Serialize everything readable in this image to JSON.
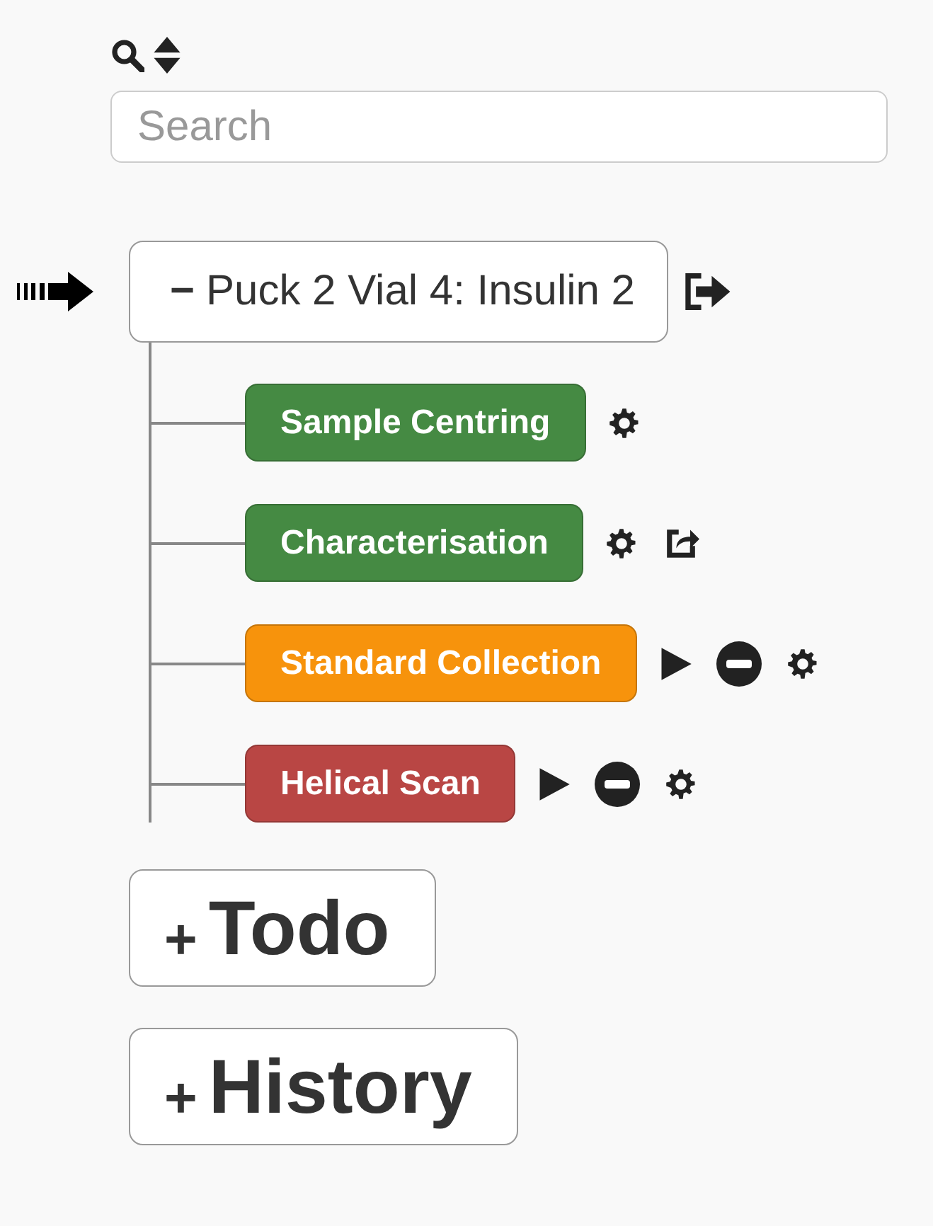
{
  "search": {
    "placeholder": "Search"
  },
  "sample": {
    "sign": "−",
    "label": "Puck 2 Vial 4: Insulin 2",
    "current": true
  },
  "tasks": [
    {
      "label": "Sample Centring",
      "color": "#458a43",
      "actions": [
        {
          "kind": "settings"
        }
      ]
    },
    {
      "label": "Characterisation",
      "color": "#458a43",
      "actions": [
        {
          "kind": "settings"
        },
        {
          "kind": "share"
        }
      ]
    },
    {
      "label": "Standard Collection",
      "color": "#f7930c",
      "actions": [
        {
          "kind": "play"
        },
        {
          "kind": "remove"
        },
        {
          "kind": "settings"
        }
      ]
    },
    {
      "label": "Helical Scan",
      "color": "#b94644",
      "actions": [
        {
          "kind": "play"
        },
        {
          "kind": "remove"
        },
        {
          "kind": "settings"
        }
      ]
    }
  ],
  "sections": [
    {
      "sign": "+",
      "label": "Todo"
    },
    {
      "sign": "+",
      "label": "History"
    }
  ]
}
